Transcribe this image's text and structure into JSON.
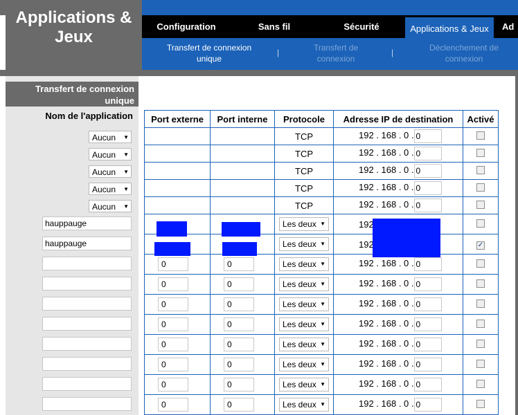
{
  "page": {
    "title": "Applications & Jeux"
  },
  "tabs": [
    "Configuration",
    "Sans fil",
    "Sécurité",
    "Applications & Jeux",
    "Ad"
  ],
  "subtabs": [
    "Transfert de connexion unique",
    "Transfert de connexion",
    "Déclenchement de connexion"
  ],
  "section": {
    "title": "Transfert de connexion unique"
  },
  "columns": {
    "app_name": "Nom de l'application",
    "ext_port": "Port externe",
    "int_port": "Port interne",
    "protocol": "Protocole",
    "dest_ip": "Adresse IP de destination",
    "enabled": "Activé"
  },
  "ip_prefix": "192 . 168 . 0 .",
  "ip_prefix_short": "192",
  "app_rows": [
    {
      "app": "Aucun",
      "type": "select",
      "protocol": "TCP",
      "octet": "0",
      "enabled": false
    },
    {
      "app": "Aucun",
      "type": "select",
      "protocol": "TCP",
      "octet": "0",
      "enabled": false
    },
    {
      "app": "Aucun",
      "type": "select",
      "protocol": "TCP",
      "octet": "0",
      "enabled": false
    },
    {
      "app": "Aucun",
      "type": "select",
      "protocol": "TCP",
      "octet": "0",
      "enabled": false
    },
    {
      "app": "Aucun",
      "type": "select",
      "protocol": "TCP",
      "octet": "0",
      "enabled": false
    },
    {
      "app": "hauppauge",
      "type": "text",
      "protocol": "Les deux",
      "enabled": false
    },
    {
      "app": "hauppauge",
      "type": "text",
      "protocol": "Les deux",
      "enabled": true
    },
    {
      "app": "",
      "type": "text",
      "ext": "0",
      "int": "0",
      "protocol": "Les deux",
      "octet": "0",
      "enabled": false
    },
    {
      "app": "",
      "type": "text",
      "ext": "0",
      "int": "0",
      "protocol": "Les deux",
      "octet": "0",
      "enabled": false
    },
    {
      "app": "",
      "type": "text",
      "ext": "0",
      "int": "0",
      "protocol": "Les deux",
      "octet": "0",
      "enabled": false
    },
    {
      "app": "",
      "type": "text",
      "ext": "0",
      "int": "0",
      "protocol": "Les deux",
      "octet": "0",
      "enabled": false
    },
    {
      "app": "",
      "type": "text",
      "ext": "0",
      "int": "0",
      "protocol": "Les deux",
      "octet": "0",
      "enabled": false
    },
    {
      "app": "",
      "type": "text",
      "ext": "0",
      "int": "0",
      "protocol": "Les deux",
      "octet": "0",
      "enabled": false
    },
    {
      "app": "",
      "type": "text",
      "ext": "0",
      "int": "0",
      "protocol": "Les deux",
      "octet": "0",
      "enabled": false
    },
    {
      "app": "",
      "type": "text",
      "ext": "0",
      "int": "0",
      "protocol": "Les deux",
      "octet": "0",
      "enabled": false
    }
  ],
  "colors": {
    "accent": "#1b62b8",
    "gray": "#6a6a6a",
    "redaction": "#0019ff"
  }
}
